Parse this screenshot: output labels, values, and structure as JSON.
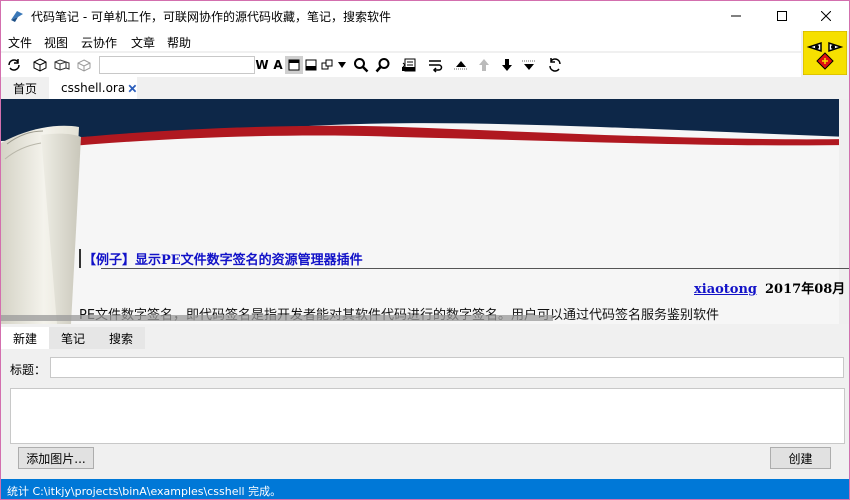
{
  "window": {
    "title": "代码笔记 - 可单机工作，可联网协作的源代码收藏，笔记，搜索软件",
    "border_color": "#d36fae"
  },
  "menu": {
    "items": [
      "文件",
      "视图",
      "云协作",
      "文章",
      "帮助"
    ]
  },
  "toolbar": {
    "search_value": "",
    "font_bold_label": "W",
    "font_size_label": "A",
    "icons": [
      "refresh-icon",
      "cube-icon",
      "cube-stack-icon",
      "cube-outline-icon",
      "font-bold-icon",
      "font-size-icon",
      "layout-single-icon",
      "layout-split-icon",
      "layout-windows-icon",
      "dropdown-icon",
      "search-icon",
      "zoom-icon",
      "print-icon",
      "wrap-icon",
      "collapse-up-icon",
      "arrow-up-icon",
      "arrow-down-icon",
      "expand-down-icon",
      "sync-icon"
    ]
  },
  "tabs": {
    "home_label": "首页",
    "file_label": "csshell.ora"
  },
  "article": {
    "title": "【例子】显示PE文件数字签名的资源管理器插件",
    "author": "xiaotong",
    "date": "2017年08月",
    "body": "PE文件数字签名，即代码签名是指开发者能对其软件代码进行的数字签名。用户可以通过代码签名服务鉴别软件"
  },
  "lower_tabs": {
    "new_label": "新建",
    "notes_label": "笔记",
    "search_label": "搜索"
  },
  "form": {
    "title_label": "标题：",
    "title_value": "",
    "body_value": "",
    "add_image_label": "添加图片...",
    "create_label": "创建"
  },
  "status": {
    "text": "统计 C:\\itkjy\\projects\\binA\\examples\\csshell 完成。",
    "color": "#0078d7"
  },
  "colors": {
    "link": "#1212c8",
    "banner_navy": "#0d2748",
    "banner_red": "#b01820"
  }
}
